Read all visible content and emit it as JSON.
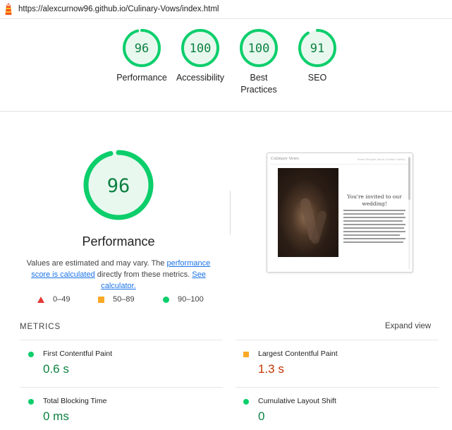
{
  "url_bar": {
    "url": "https://alexcurnow96.github.io/Culinary-Vows/index.html",
    "logo_icon": "lighthouse-icon"
  },
  "category_scores": [
    {
      "score": 96,
      "label": "Performance"
    },
    {
      "score": 100,
      "label": "Accessibility"
    },
    {
      "score": 100,
      "label": "Best Practices"
    },
    {
      "score": 91,
      "label": "SEO"
    }
  ],
  "performance": {
    "score": 96,
    "title": "Performance",
    "desc_1": "Values are estimated and may vary. The ",
    "link_score": "performance score is calculated",
    "desc_2": " directly from these metrics. ",
    "link_calc": "See calculator."
  },
  "legend": {
    "fail": "0–49",
    "average": "50–89",
    "pass": "90–100"
  },
  "preview": {
    "brand": "Culinary Vows",
    "nav": "Home   Recipes   About   Contact   Gallery",
    "heading": "You're invited to our wedding!"
  },
  "metrics": {
    "heading": "METRICS",
    "expand_label": "Expand view",
    "fcp": {
      "label": "First Contentful Paint",
      "value": "0.6 s"
    },
    "lcp": {
      "label": "Largest Contentful Paint",
      "value": "1.3 s"
    },
    "tbt": {
      "label": "Total Blocking Time",
      "value": "0 ms"
    },
    "cls": {
      "label": "Cumulative Layout Shift",
      "value": "0"
    }
  },
  "colors": {
    "pass": "#0cce6b",
    "pass_text": "#0c8040",
    "average": "#f9a825",
    "average_text": "#c33300",
    "fail": "#e53935",
    "link": "#1a73e8"
  }
}
